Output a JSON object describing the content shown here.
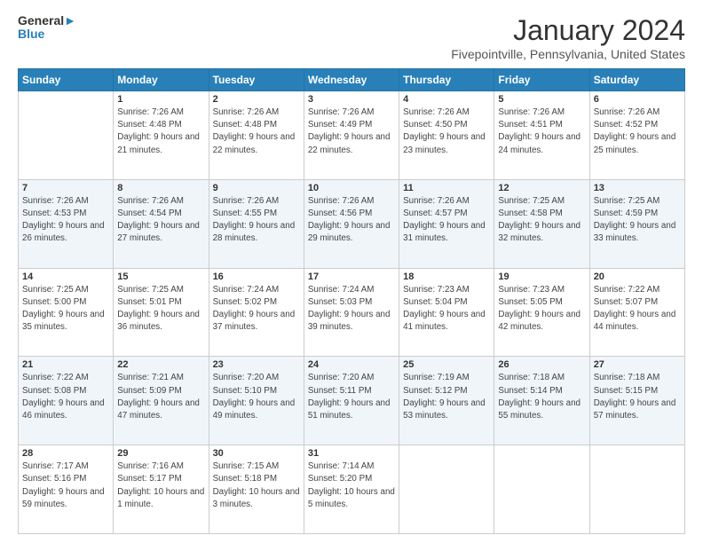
{
  "header": {
    "logo_line1": "General",
    "logo_line2": "Blue",
    "month": "January 2024",
    "location": "Fivepointville, Pennsylvania, United States"
  },
  "days": [
    "Sunday",
    "Monday",
    "Tuesday",
    "Wednesday",
    "Thursday",
    "Friday",
    "Saturday"
  ],
  "weeks": [
    [
      {
        "num": "",
        "sunrise": "",
        "sunset": "",
        "daylight": ""
      },
      {
        "num": "1",
        "sunrise": "Sunrise: 7:26 AM",
        "sunset": "Sunset: 4:48 PM",
        "daylight": "Daylight: 9 hours and 21 minutes."
      },
      {
        "num": "2",
        "sunrise": "Sunrise: 7:26 AM",
        "sunset": "Sunset: 4:48 PM",
        "daylight": "Daylight: 9 hours and 22 minutes."
      },
      {
        "num": "3",
        "sunrise": "Sunrise: 7:26 AM",
        "sunset": "Sunset: 4:49 PM",
        "daylight": "Daylight: 9 hours and 22 minutes."
      },
      {
        "num": "4",
        "sunrise": "Sunrise: 7:26 AM",
        "sunset": "Sunset: 4:50 PM",
        "daylight": "Daylight: 9 hours and 23 minutes."
      },
      {
        "num": "5",
        "sunrise": "Sunrise: 7:26 AM",
        "sunset": "Sunset: 4:51 PM",
        "daylight": "Daylight: 9 hours and 24 minutes."
      },
      {
        "num": "6",
        "sunrise": "Sunrise: 7:26 AM",
        "sunset": "Sunset: 4:52 PM",
        "daylight": "Daylight: 9 hours and 25 minutes."
      }
    ],
    [
      {
        "num": "7",
        "sunrise": "Sunrise: 7:26 AM",
        "sunset": "Sunset: 4:53 PM",
        "daylight": "Daylight: 9 hours and 26 minutes."
      },
      {
        "num": "8",
        "sunrise": "Sunrise: 7:26 AM",
        "sunset": "Sunset: 4:54 PM",
        "daylight": "Daylight: 9 hours and 27 minutes."
      },
      {
        "num": "9",
        "sunrise": "Sunrise: 7:26 AM",
        "sunset": "Sunset: 4:55 PM",
        "daylight": "Daylight: 9 hours and 28 minutes."
      },
      {
        "num": "10",
        "sunrise": "Sunrise: 7:26 AM",
        "sunset": "Sunset: 4:56 PM",
        "daylight": "Daylight: 9 hours and 29 minutes."
      },
      {
        "num": "11",
        "sunrise": "Sunrise: 7:26 AM",
        "sunset": "Sunset: 4:57 PM",
        "daylight": "Daylight: 9 hours and 31 minutes."
      },
      {
        "num": "12",
        "sunrise": "Sunrise: 7:25 AM",
        "sunset": "Sunset: 4:58 PM",
        "daylight": "Daylight: 9 hours and 32 minutes."
      },
      {
        "num": "13",
        "sunrise": "Sunrise: 7:25 AM",
        "sunset": "Sunset: 4:59 PM",
        "daylight": "Daylight: 9 hours and 33 minutes."
      }
    ],
    [
      {
        "num": "14",
        "sunrise": "Sunrise: 7:25 AM",
        "sunset": "Sunset: 5:00 PM",
        "daylight": "Daylight: 9 hours and 35 minutes."
      },
      {
        "num": "15",
        "sunrise": "Sunrise: 7:25 AM",
        "sunset": "Sunset: 5:01 PM",
        "daylight": "Daylight: 9 hours and 36 minutes."
      },
      {
        "num": "16",
        "sunrise": "Sunrise: 7:24 AM",
        "sunset": "Sunset: 5:02 PM",
        "daylight": "Daylight: 9 hours and 37 minutes."
      },
      {
        "num": "17",
        "sunrise": "Sunrise: 7:24 AM",
        "sunset": "Sunset: 5:03 PM",
        "daylight": "Daylight: 9 hours and 39 minutes."
      },
      {
        "num": "18",
        "sunrise": "Sunrise: 7:23 AM",
        "sunset": "Sunset: 5:04 PM",
        "daylight": "Daylight: 9 hours and 41 minutes."
      },
      {
        "num": "19",
        "sunrise": "Sunrise: 7:23 AM",
        "sunset": "Sunset: 5:05 PM",
        "daylight": "Daylight: 9 hours and 42 minutes."
      },
      {
        "num": "20",
        "sunrise": "Sunrise: 7:22 AM",
        "sunset": "Sunset: 5:07 PM",
        "daylight": "Daylight: 9 hours and 44 minutes."
      }
    ],
    [
      {
        "num": "21",
        "sunrise": "Sunrise: 7:22 AM",
        "sunset": "Sunset: 5:08 PM",
        "daylight": "Daylight: 9 hours and 46 minutes."
      },
      {
        "num": "22",
        "sunrise": "Sunrise: 7:21 AM",
        "sunset": "Sunset: 5:09 PM",
        "daylight": "Daylight: 9 hours and 47 minutes."
      },
      {
        "num": "23",
        "sunrise": "Sunrise: 7:20 AM",
        "sunset": "Sunset: 5:10 PM",
        "daylight": "Daylight: 9 hours and 49 minutes."
      },
      {
        "num": "24",
        "sunrise": "Sunrise: 7:20 AM",
        "sunset": "Sunset: 5:11 PM",
        "daylight": "Daylight: 9 hours and 51 minutes."
      },
      {
        "num": "25",
        "sunrise": "Sunrise: 7:19 AM",
        "sunset": "Sunset: 5:12 PM",
        "daylight": "Daylight: 9 hours and 53 minutes."
      },
      {
        "num": "26",
        "sunrise": "Sunrise: 7:18 AM",
        "sunset": "Sunset: 5:14 PM",
        "daylight": "Daylight: 9 hours and 55 minutes."
      },
      {
        "num": "27",
        "sunrise": "Sunrise: 7:18 AM",
        "sunset": "Sunset: 5:15 PM",
        "daylight": "Daylight: 9 hours and 57 minutes."
      }
    ],
    [
      {
        "num": "28",
        "sunrise": "Sunrise: 7:17 AM",
        "sunset": "Sunset: 5:16 PM",
        "daylight": "Daylight: 9 hours and 59 minutes."
      },
      {
        "num": "29",
        "sunrise": "Sunrise: 7:16 AM",
        "sunset": "Sunset: 5:17 PM",
        "daylight": "Daylight: 10 hours and 1 minute."
      },
      {
        "num": "30",
        "sunrise": "Sunrise: 7:15 AM",
        "sunset": "Sunset: 5:18 PM",
        "daylight": "Daylight: 10 hours and 3 minutes."
      },
      {
        "num": "31",
        "sunrise": "Sunrise: 7:14 AM",
        "sunset": "Sunset: 5:20 PM",
        "daylight": "Daylight: 10 hours and 5 minutes."
      },
      {
        "num": "",
        "sunrise": "",
        "sunset": "",
        "daylight": ""
      },
      {
        "num": "",
        "sunrise": "",
        "sunset": "",
        "daylight": ""
      },
      {
        "num": "",
        "sunrise": "",
        "sunset": "",
        "daylight": ""
      }
    ]
  ]
}
